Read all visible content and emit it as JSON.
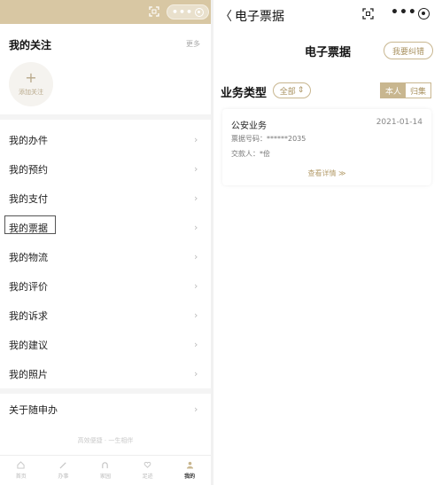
{
  "left": {
    "favorites": {
      "title": "我的关注",
      "more": "更多",
      "add_label": "添加关注",
      "add_symbol": "+"
    },
    "menu": [
      {
        "label": "我的办件"
      },
      {
        "label": "我的预约"
      },
      {
        "label": "我的支付"
      },
      {
        "label": "我的票据"
      },
      {
        "label": "我的物流"
      },
      {
        "label": "我的评价"
      },
      {
        "label": "我的诉求"
      },
      {
        "label": "我的建议"
      },
      {
        "label": "我的照片"
      }
    ],
    "about": {
      "label": "关于随申办"
    },
    "chevron": "›",
    "slogan": "高效便捷 · 一生相伴",
    "tabs": [
      {
        "label": "首页",
        "icon": "home-icon"
      },
      {
        "label": "办事",
        "icon": "pen-icon"
      },
      {
        "label": "家园",
        "icon": "horseshoe-icon"
      },
      {
        "label": "足迹",
        "icon": "heart-hands-icon"
      },
      {
        "label": "我的",
        "icon": "person-icon",
        "active": true
      }
    ],
    "capsule_dots": "•••"
  },
  "right": {
    "nav_title": "电子票据",
    "back_symbol": "〈",
    "dots": "•••",
    "page_title": "电子票据",
    "correct_button": "我要纠错",
    "business_type_label": "业务类型",
    "filter": {
      "label": "全部",
      "arrow": "⇕"
    },
    "toggle": [
      {
        "label": "本人",
        "active": true
      },
      {
        "label": "归集",
        "active": false
      }
    ],
    "card": {
      "type": "公安业务",
      "date": "2021-01-14",
      "receipt_no": "票据号码：******2035",
      "payer": "交款人：*侩",
      "detail_link": "查看详情  ≫"
    }
  },
  "colors": {
    "accent": "#c8b68f",
    "accent_text": "#a8915f",
    "topbar": "#d8c7a3"
  }
}
